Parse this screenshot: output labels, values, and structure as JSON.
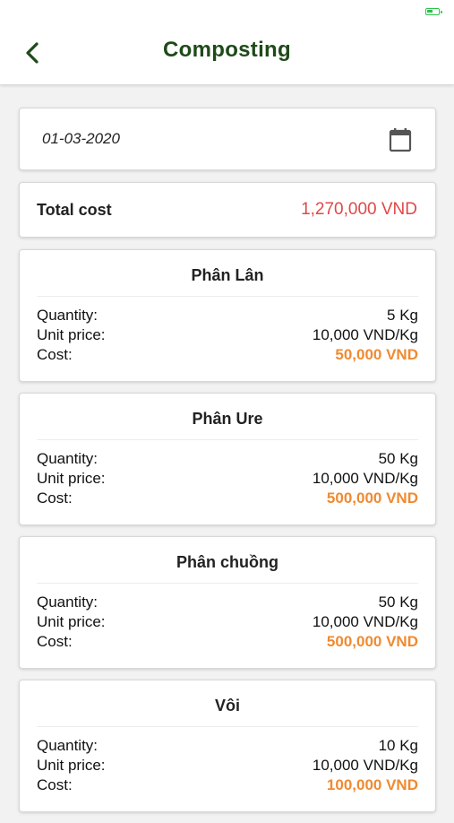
{
  "header": {
    "title": "Composting"
  },
  "date": {
    "value": "01-03-2020"
  },
  "total": {
    "label": "Total cost",
    "value": "1,270,000 VND"
  },
  "row_labels": {
    "quantity": "Quantity:",
    "unit_price": "Unit price:",
    "cost": "Cost:"
  },
  "items": [
    {
      "name": "Phân Lân",
      "quantity": "5 Kg",
      "unit_price": "10,000 VND/Kg",
      "cost": "50,000 VND"
    },
    {
      "name": "Phân Ure",
      "quantity": "50 Kg",
      "unit_price": "10,000 VND/Kg",
      "cost": "500,000 VND"
    },
    {
      "name": "Phân chuồng",
      "quantity": "50 Kg",
      "unit_price": "10,000 VND/Kg",
      "cost": "500,000 VND"
    },
    {
      "name": "Vôi",
      "quantity": "10 Kg",
      "unit_price": "10,000 VND/Kg",
      "cost": "100,000 VND"
    }
  ],
  "colors": {
    "title_green": "#1f4a1a",
    "total_red": "#e04848",
    "cost_orange": "#f08a30",
    "battery_green": "#2ec24a"
  },
  "icons": {
    "back": "chevron-left-icon",
    "calendar": "calendar-icon",
    "battery": "battery-icon"
  }
}
